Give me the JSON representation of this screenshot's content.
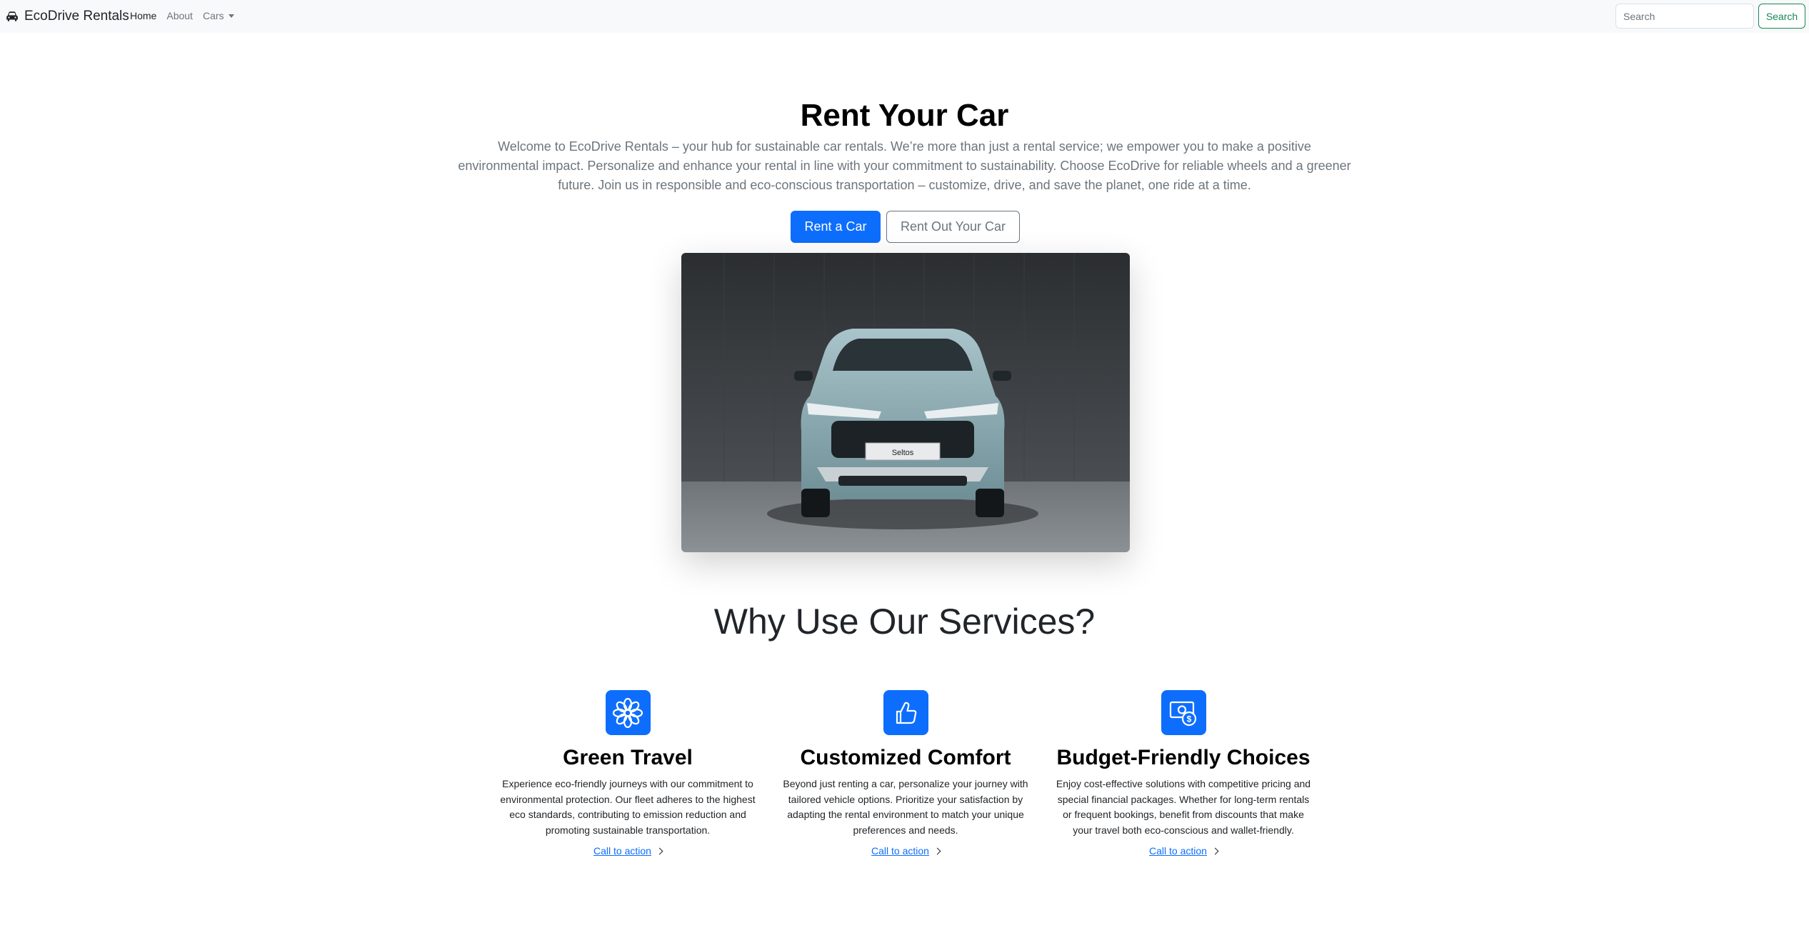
{
  "navbar": {
    "brand": "EcoDrive Rentals",
    "brand_icon": "car-icon",
    "links": [
      "Home",
      "About",
      "Cars"
    ],
    "search_placeholder": "Search",
    "search_button": "Search"
  },
  "hero": {
    "title": "Rent Your Car",
    "lead": "Welcome to EcoDrive Rentals – your hub for sustainable car rentals. We’re more than just a rental service; we empower you to make a positive environmental impact. Personalize and enhance your rental in line with your commitment to sustainability. Choose EcoDrive for reliable wheels and a greener future. Join us in responsible and eco-conscious transportation – customize, drive, and save the planet, one ride at a time.",
    "primary_button": "Rent a Car",
    "secondary_button": "Rent Out Your Car",
    "image_plate": "Seltos"
  },
  "services": {
    "title": "Why Use Our Services?",
    "features": [
      {
        "icon": "flower-icon",
        "title": "Green Travel",
        "text": "Experience eco-friendly journeys with our commitment to environmental protection. Our fleet adheres to the highest eco standards, contributing to emission reduction and promoting sustainable transportation.",
        "link": "Call to action"
      },
      {
        "icon": "thumbs-up-icon",
        "title": "Customized Comfort",
        "text": "Beyond just renting a car, personalize your journey with tailored vehicle options. Prioritize your satisfaction by adapting the rental environment to match your unique preferences and needs.",
        "link": "Call to action"
      },
      {
        "icon": "cash-coin-icon",
        "title": "Budget-Friendly Choices",
        "text": "Enjoy cost-effective solutions with competitive pricing and special financial packages. Whether for long-term rentals or frequent bookings, benefit from discounts that make your travel both eco-conscious and wallet-friendly.",
        "link": "Call to action"
      }
    ]
  },
  "colors": {
    "primary": "#0d6efd",
    "success": "#198754",
    "muted": "#6c757d",
    "navbar_bg": "#f8f9fa"
  }
}
